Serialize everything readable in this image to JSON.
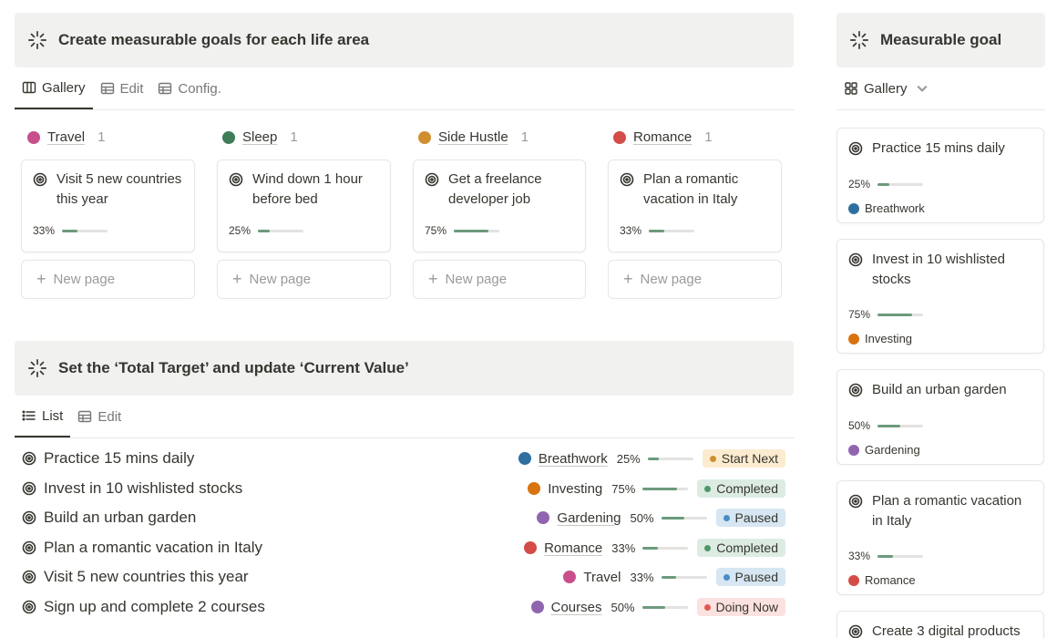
{
  "left": {
    "banner1": {
      "title": "Create measurable goals for each life area"
    },
    "tabs1": [
      {
        "label": "Gallery",
        "icon": "gallery-icon",
        "active": true
      },
      {
        "label": "Edit",
        "icon": "table-icon",
        "active": false
      },
      {
        "label": "Config.",
        "icon": "table-icon",
        "active": false
      }
    ],
    "columns": [
      {
        "name": "Travel",
        "count": "1",
        "color": "#c94f8c",
        "card": {
          "title": "Visit 5 new countries this year",
          "percent": "33%",
          "progress": 0.33
        },
        "new_page": "New page"
      },
      {
        "name": "Sleep",
        "count": "1",
        "color": "#3f7d5a",
        "card": {
          "title": "Wind down 1 hour before bed",
          "percent": "25%",
          "progress": 0.25
        },
        "new_page": "New page"
      },
      {
        "name": "Side Hustle",
        "count": "1",
        "color": "#cf8f2e",
        "card": {
          "title": "Get a freelance developer job",
          "percent": "75%",
          "progress": 0.75
        },
        "new_page": "New page"
      },
      {
        "name": "Romance",
        "count": "1",
        "color": "#d44c47",
        "card": {
          "title": "Plan a romantic vacation in Italy",
          "percent": "33%",
          "progress": 0.33
        },
        "new_page": "New page"
      }
    ],
    "banner2": {
      "title": "Set the ‘Total Target’ and update ‘Current Value’"
    },
    "tabs2": [
      {
        "label": "List",
        "icon": "list-icon",
        "active": true
      },
      {
        "label": "Edit",
        "icon": "table-icon",
        "active": false
      }
    ],
    "rows": [
      {
        "title": "Practice 15 mins daily",
        "area": "Breathwork",
        "area_color": "#2e6fa0",
        "underline": true,
        "percent": "25%",
        "progress": 0.25,
        "status": "Start Next",
        "status_bg": "#fbecd0",
        "status_dot": "#cf8f2e",
        "status_fg": "#37352f"
      },
      {
        "title": "Invest in 10 wishlisted stocks",
        "area": "Investing",
        "area_color": "#d9730d",
        "underline": false,
        "percent": "75%",
        "progress": 0.75,
        "status": "Completed",
        "status_bg": "#dcece3",
        "status_dot": "#4f9768",
        "status_fg": "#37352f"
      },
      {
        "title": "Build an urban garden",
        "area": "Gardening",
        "area_color": "#9065b0",
        "underline": true,
        "percent": "50%",
        "progress": 0.5,
        "status": "Paused",
        "status_bg": "#d6e6f2",
        "status_dot": "#4a8cc7",
        "status_fg": "#37352f"
      },
      {
        "title": "Plan a romantic vacation in Italy",
        "area": "Romance",
        "area_color": "#d44c47",
        "underline": true,
        "percent": "33%",
        "progress": 0.33,
        "status": "Completed",
        "status_bg": "#dcece3",
        "status_dot": "#4f9768",
        "status_fg": "#37352f"
      },
      {
        "title": "Visit 5 new countries this year",
        "area": "Travel",
        "area_color": "#c94f8c",
        "underline": false,
        "percent": "33%",
        "progress": 0.33,
        "status": "Paused",
        "status_bg": "#d6e6f2",
        "status_dot": "#4a8cc7",
        "status_fg": "#37352f"
      },
      {
        "title": "Sign up and complete 2 courses",
        "area": "Courses",
        "area_color": "#9065b0",
        "underline": true,
        "percent": "50%",
        "progress": 0.5,
        "status": "Doing Now",
        "status_bg": "#fbe2e0",
        "status_dot": "#e05a55",
        "status_fg": "#37352f"
      }
    ]
  },
  "right": {
    "banner": {
      "title": "Measurable goal"
    },
    "tab": {
      "label": "Gallery",
      "icon": "gallery-icon"
    },
    "cards": [
      {
        "title": "Practice 15 mins daily",
        "percent": "25%",
        "progress": 0.25,
        "tag": "Breathwork",
        "tag_color": "#2e6fa0"
      },
      {
        "title": "Invest in 10 wishlisted stocks",
        "percent": "75%",
        "progress": 0.75,
        "tag": "Investing",
        "tag_color": "#d9730d"
      },
      {
        "title": "Build an urban garden",
        "percent": "50%",
        "progress": 0.5,
        "tag": "Gardening",
        "tag_color": "#9065b0"
      },
      {
        "title": "Plan a romantic vacation in Italy",
        "percent": "33%",
        "progress": 0.33,
        "tag": "Romance",
        "tag_color": "#d44c47"
      },
      {
        "title": "Create 3 digital products",
        "percent": "",
        "progress": null,
        "tag": "",
        "tag_color": ""
      }
    ]
  }
}
